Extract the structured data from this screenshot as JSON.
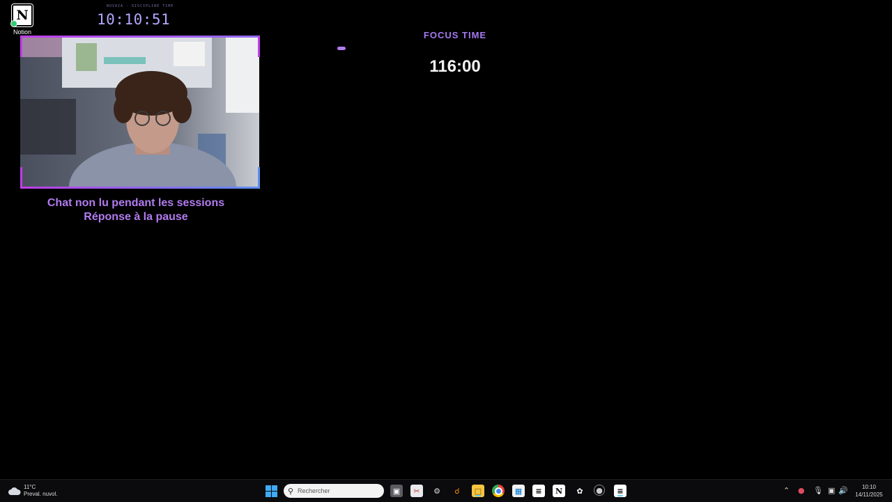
{
  "desktop": {
    "notion_icon_label": "Notion",
    "notion_logo_letter": "N"
  },
  "overlay": {
    "small_caption": "NOVAIA · DISCIPLINE TIME",
    "clock": "10:10:51",
    "notice_line1": "Chat non lu pendant les sessions",
    "notice_line2": "Réponse à la pause",
    "focus_label": "FOCUS TIME",
    "focus_time": "116:00",
    "accent_color": "#b27cf0",
    "border_color": "#c03de8"
  },
  "taskbar": {
    "weather_temp": "11°C",
    "weather_desc": "Preval. nuvol.",
    "search_placeholder": "Rechercher",
    "time": "10:10",
    "date": "14/11/2025",
    "pinned_icons": [
      "task-view-icon",
      "snipping-tool-icon",
      "settings-icon",
      "search-app-icon",
      "file-explorer-icon",
      "chrome-icon",
      "microsoft-store-icon",
      "capcut-icon",
      "notion-icon",
      "chatgpt-icon",
      "obs-icon",
      "capcut-active-icon"
    ],
    "tray_icons": [
      "chevron-up-icon",
      "app-tray-icon",
      "microphone-icon",
      "network-icon",
      "volume-icon"
    ]
  }
}
